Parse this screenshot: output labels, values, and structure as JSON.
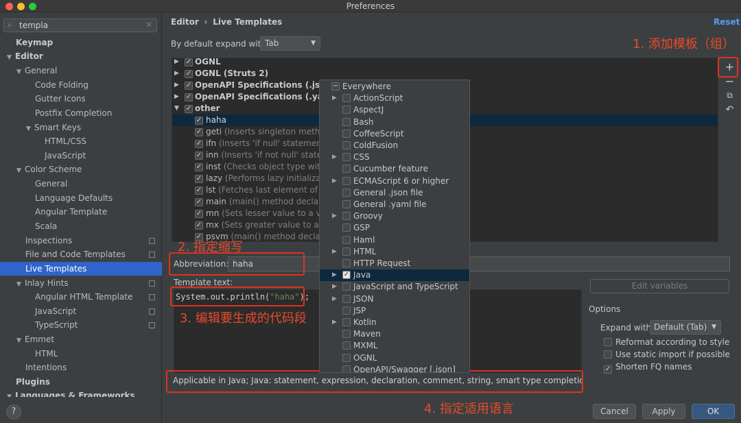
{
  "window": {
    "title": "Preferences"
  },
  "search": {
    "value": "templa"
  },
  "sidebar": {
    "items": [
      {
        "label": "Keymap"
      },
      {
        "label": "Editor"
      },
      {
        "label": "General"
      },
      {
        "label": "Code Folding"
      },
      {
        "label": "Gutter Icons"
      },
      {
        "label": "Postfix Completion"
      },
      {
        "label": "Smart Keys"
      },
      {
        "label": "HTML/CSS"
      },
      {
        "label": "JavaScript"
      },
      {
        "label": "Color Scheme"
      },
      {
        "label": "General"
      },
      {
        "label": "Language Defaults"
      },
      {
        "label": "Angular Template"
      },
      {
        "label": "Scala"
      },
      {
        "label": "Inspections"
      },
      {
        "label": "File and Code Templates"
      },
      {
        "label": "Live Templates"
      },
      {
        "label": "Inlay Hints"
      },
      {
        "label": "Angular HTML Template"
      },
      {
        "label": "JavaScript"
      },
      {
        "label": "TypeScript"
      },
      {
        "label": "Emmet"
      },
      {
        "label": "HTML"
      },
      {
        "label": "Intentions"
      },
      {
        "label": "Plugins"
      },
      {
        "label": "Languages & Frameworks"
      }
    ]
  },
  "header": {
    "crumb_parent": "Editor",
    "crumb_sep": "›",
    "crumb_current": "Live Templates",
    "reset": "Reset"
  },
  "expand": {
    "label": "By default expand with",
    "value": "Tab"
  },
  "templates": {
    "groups": [
      {
        "name": "OGNL"
      },
      {
        "name": "OGNL (Struts 2)"
      },
      {
        "name": "OpenAPI Specifications (.json)"
      },
      {
        "name": "OpenAPI Specifications (.yaml)"
      },
      {
        "name": "other"
      }
    ],
    "items": [
      {
        "abbr": "haha",
        "desc": ""
      },
      {
        "abbr": "geti",
        "desc": "(Inserts singleton method"
      },
      {
        "abbr": "ifn",
        "desc": "(Inserts 'if null' statement)"
      },
      {
        "abbr": "inn",
        "desc": "(Inserts 'if not null' stateme"
      },
      {
        "abbr": "inst",
        "desc": "(Checks object type with i"
      },
      {
        "abbr": "lazy",
        "desc": "(Performs lazy initializatic"
      },
      {
        "abbr": "lst",
        "desc": "(Fetches last element of an"
      },
      {
        "abbr": "main",
        "desc": "(main() method declarati"
      },
      {
        "abbr": "mn",
        "desc": "(Sets lesser value to a vari"
      },
      {
        "abbr": "mx",
        "desc": "(Sets greater value to a var"
      },
      {
        "abbr": "psvm",
        "desc": "(main() method declarat"
      }
    ]
  },
  "context_popup": {
    "items": [
      {
        "label": "Everywhere",
        "checked": false,
        "expandable": false
      },
      {
        "label": "ActionScript",
        "checked": false,
        "expandable": true
      },
      {
        "label": "AspectJ",
        "checked": false,
        "expandable": false
      },
      {
        "label": "Bash",
        "checked": false,
        "expandable": false
      },
      {
        "label": "CoffeeScript",
        "checked": false,
        "expandable": false
      },
      {
        "label": "ColdFusion",
        "checked": false,
        "expandable": false
      },
      {
        "label": "CSS",
        "checked": false,
        "expandable": true
      },
      {
        "label": "Cucumber feature",
        "checked": false,
        "expandable": false
      },
      {
        "label": "ECMAScript 6 or higher",
        "checked": false,
        "expandable": true
      },
      {
        "label": "General .json file",
        "checked": false,
        "expandable": false
      },
      {
        "label": "General .yaml file",
        "checked": false,
        "expandable": false
      },
      {
        "label": "Groovy",
        "checked": false,
        "expandable": true
      },
      {
        "label": "GSP",
        "checked": false,
        "expandable": false
      },
      {
        "label": "Haml",
        "checked": false,
        "expandable": false
      },
      {
        "label": "HTML",
        "checked": false,
        "expandable": true
      },
      {
        "label": "HTTP Request",
        "checked": false,
        "expandable": false
      },
      {
        "label": "Java",
        "checked": true,
        "expandable": true
      },
      {
        "label": "JavaScript and TypeScript",
        "checked": false,
        "expandable": true
      },
      {
        "label": "JSON",
        "checked": false,
        "expandable": true
      },
      {
        "label": "JSP",
        "checked": false,
        "expandable": false
      },
      {
        "label": "Kotlin",
        "checked": false,
        "expandable": true
      },
      {
        "label": "Maven",
        "checked": false,
        "expandable": false
      },
      {
        "label": "MXML",
        "checked": false,
        "expandable": false
      },
      {
        "label": "OGNL",
        "checked": false,
        "expandable": false
      },
      {
        "label": "OpenAPI/Swagger [.json]",
        "checked": false,
        "expandable": false
      }
    ]
  },
  "abbreviation": {
    "label": "Abbreviation:",
    "value": "haha"
  },
  "template_text": {
    "label": "Template text:",
    "code_prefix": "System.out.println(",
    "code_string": "\"haha\"",
    "code_suffix": ");"
  },
  "edit_variables": "Edit variables",
  "options": {
    "title": "Options",
    "expand_with_label": "Expand with",
    "expand_with_value": "Default (Tab)",
    "reformat": "Reformat according to style",
    "static_import": "Use static import if possible",
    "shorten_fq": "Shorten FQ names"
  },
  "applicable": {
    "text": "Applicable in Java; Java: statement, expression, declaration, comment, string, smart type completion...",
    "more": "… ⌄"
  },
  "annotations": {
    "a1": "1. 添加模板（组）",
    "a2": "2. 指定缩写",
    "a3": "3. 编辑要生成的代码段",
    "a4": "4. 指定适用语言"
  },
  "footer": {
    "help": "?",
    "cancel": "Cancel",
    "apply": "Apply",
    "ok": "OK"
  },
  "colors": {
    "accent": "#2f65ca",
    "annotation": "#e94a2a",
    "link": "#589df6"
  }
}
